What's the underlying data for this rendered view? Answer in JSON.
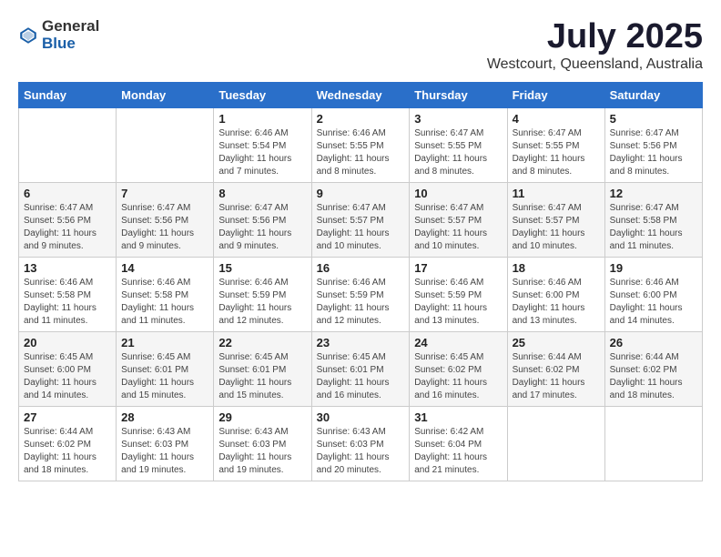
{
  "header": {
    "logo_general": "General",
    "logo_blue": "Blue",
    "month_title": "July 2025",
    "location": "Westcourt, Queensland, Australia"
  },
  "days_of_week": [
    "Sunday",
    "Monday",
    "Tuesday",
    "Wednesday",
    "Thursday",
    "Friday",
    "Saturday"
  ],
  "weeks": [
    [
      {
        "day": "",
        "sunrise": "",
        "sunset": "",
        "daylight": ""
      },
      {
        "day": "",
        "sunrise": "",
        "sunset": "",
        "daylight": ""
      },
      {
        "day": "1",
        "sunrise": "Sunrise: 6:46 AM",
        "sunset": "Sunset: 5:54 PM",
        "daylight": "Daylight: 11 hours and 7 minutes."
      },
      {
        "day": "2",
        "sunrise": "Sunrise: 6:46 AM",
        "sunset": "Sunset: 5:55 PM",
        "daylight": "Daylight: 11 hours and 8 minutes."
      },
      {
        "day": "3",
        "sunrise": "Sunrise: 6:47 AM",
        "sunset": "Sunset: 5:55 PM",
        "daylight": "Daylight: 11 hours and 8 minutes."
      },
      {
        "day": "4",
        "sunrise": "Sunrise: 6:47 AM",
        "sunset": "Sunset: 5:55 PM",
        "daylight": "Daylight: 11 hours and 8 minutes."
      },
      {
        "day": "5",
        "sunrise": "Sunrise: 6:47 AM",
        "sunset": "Sunset: 5:56 PM",
        "daylight": "Daylight: 11 hours and 8 minutes."
      }
    ],
    [
      {
        "day": "6",
        "sunrise": "Sunrise: 6:47 AM",
        "sunset": "Sunset: 5:56 PM",
        "daylight": "Daylight: 11 hours and 9 minutes."
      },
      {
        "day": "7",
        "sunrise": "Sunrise: 6:47 AM",
        "sunset": "Sunset: 5:56 PM",
        "daylight": "Daylight: 11 hours and 9 minutes."
      },
      {
        "day": "8",
        "sunrise": "Sunrise: 6:47 AM",
        "sunset": "Sunset: 5:56 PM",
        "daylight": "Daylight: 11 hours and 9 minutes."
      },
      {
        "day": "9",
        "sunrise": "Sunrise: 6:47 AM",
        "sunset": "Sunset: 5:57 PM",
        "daylight": "Daylight: 11 hours and 10 minutes."
      },
      {
        "day": "10",
        "sunrise": "Sunrise: 6:47 AM",
        "sunset": "Sunset: 5:57 PM",
        "daylight": "Daylight: 11 hours and 10 minutes."
      },
      {
        "day": "11",
        "sunrise": "Sunrise: 6:47 AM",
        "sunset": "Sunset: 5:57 PM",
        "daylight": "Daylight: 11 hours and 10 minutes."
      },
      {
        "day": "12",
        "sunrise": "Sunrise: 6:47 AM",
        "sunset": "Sunset: 5:58 PM",
        "daylight": "Daylight: 11 hours and 11 minutes."
      }
    ],
    [
      {
        "day": "13",
        "sunrise": "Sunrise: 6:46 AM",
        "sunset": "Sunset: 5:58 PM",
        "daylight": "Daylight: 11 hours and 11 minutes."
      },
      {
        "day": "14",
        "sunrise": "Sunrise: 6:46 AM",
        "sunset": "Sunset: 5:58 PM",
        "daylight": "Daylight: 11 hours and 11 minutes."
      },
      {
        "day": "15",
        "sunrise": "Sunrise: 6:46 AM",
        "sunset": "Sunset: 5:59 PM",
        "daylight": "Daylight: 11 hours and 12 minutes."
      },
      {
        "day": "16",
        "sunrise": "Sunrise: 6:46 AM",
        "sunset": "Sunset: 5:59 PM",
        "daylight": "Daylight: 11 hours and 12 minutes."
      },
      {
        "day": "17",
        "sunrise": "Sunrise: 6:46 AM",
        "sunset": "Sunset: 5:59 PM",
        "daylight": "Daylight: 11 hours and 13 minutes."
      },
      {
        "day": "18",
        "sunrise": "Sunrise: 6:46 AM",
        "sunset": "Sunset: 6:00 PM",
        "daylight": "Daylight: 11 hours and 13 minutes."
      },
      {
        "day": "19",
        "sunrise": "Sunrise: 6:46 AM",
        "sunset": "Sunset: 6:00 PM",
        "daylight": "Daylight: 11 hours and 14 minutes."
      }
    ],
    [
      {
        "day": "20",
        "sunrise": "Sunrise: 6:45 AM",
        "sunset": "Sunset: 6:00 PM",
        "daylight": "Daylight: 11 hours and 14 minutes."
      },
      {
        "day": "21",
        "sunrise": "Sunrise: 6:45 AM",
        "sunset": "Sunset: 6:01 PM",
        "daylight": "Daylight: 11 hours and 15 minutes."
      },
      {
        "day": "22",
        "sunrise": "Sunrise: 6:45 AM",
        "sunset": "Sunset: 6:01 PM",
        "daylight": "Daylight: 11 hours and 15 minutes."
      },
      {
        "day": "23",
        "sunrise": "Sunrise: 6:45 AM",
        "sunset": "Sunset: 6:01 PM",
        "daylight": "Daylight: 11 hours and 16 minutes."
      },
      {
        "day": "24",
        "sunrise": "Sunrise: 6:45 AM",
        "sunset": "Sunset: 6:02 PM",
        "daylight": "Daylight: 11 hours and 16 minutes."
      },
      {
        "day": "25",
        "sunrise": "Sunrise: 6:44 AM",
        "sunset": "Sunset: 6:02 PM",
        "daylight": "Daylight: 11 hours and 17 minutes."
      },
      {
        "day": "26",
        "sunrise": "Sunrise: 6:44 AM",
        "sunset": "Sunset: 6:02 PM",
        "daylight": "Daylight: 11 hours and 18 minutes."
      }
    ],
    [
      {
        "day": "27",
        "sunrise": "Sunrise: 6:44 AM",
        "sunset": "Sunset: 6:02 PM",
        "daylight": "Daylight: 11 hours and 18 minutes."
      },
      {
        "day": "28",
        "sunrise": "Sunrise: 6:43 AM",
        "sunset": "Sunset: 6:03 PM",
        "daylight": "Daylight: 11 hours and 19 minutes."
      },
      {
        "day": "29",
        "sunrise": "Sunrise: 6:43 AM",
        "sunset": "Sunset: 6:03 PM",
        "daylight": "Daylight: 11 hours and 19 minutes."
      },
      {
        "day": "30",
        "sunrise": "Sunrise: 6:43 AM",
        "sunset": "Sunset: 6:03 PM",
        "daylight": "Daylight: 11 hours and 20 minutes."
      },
      {
        "day": "31",
        "sunrise": "Sunrise: 6:42 AM",
        "sunset": "Sunset: 6:04 PM",
        "daylight": "Daylight: 11 hours and 21 minutes."
      },
      {
        "day": "",
        "sunrise": "",
        "sunset": "",
        "daylight": ""
      },
      {
        "day": "",
        "sunrise": "",
        "sunset": "",
        "daylight": ""
      }
    ]
  ]
}
